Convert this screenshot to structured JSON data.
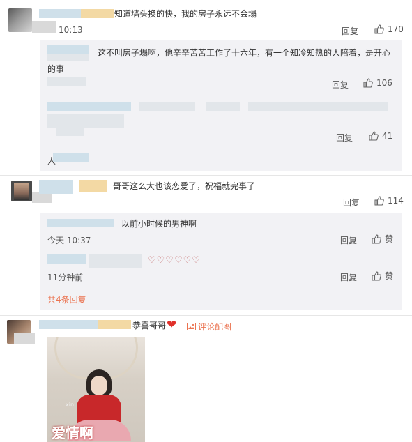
{
  "comments": [
    {
      "text": "知道墙头换的快，我的房子永远不会塌",
      "time": "10:13",
      "reply": "回复",
      "likes": "170",
      "replies": [
        {
          "text": "这不叫房子塌啊，他辛辛苦苦工作了十六年，有一个知冷知热的人陪着，是开心",
          "text2": "的事",
          "reply": "回复",
          "likes": "106"
        },
        {
          "reply": "回复",
          "likes": "41"
        }
      ],
      "more_glyph": "人"
    },
    {
      "text": "哥哥这么大也该恋爱了，祝福就完事了",
      "reply": "回复",
      "likes": "114",
      "replies": [
        {
          "text": "以前小时候的男神啊",
          "time": "今天 10:37",
          "reply": "回复",
          "likes": "赞"
        },
        {
          "emojis": "♡♡♡♡♡♡",
          "time": "11分钟前",
          "reply": "回复",
          "likes": "赞"
        }
      ],
      "total_replies": "共4条回复"
    },
    {
      "text": "恭喜哥哥",
      "heart": "❤",
      "image_link": "评论配图",
      "image_caption": "爱情啊",
      "image_watermark": "xin"
    }
  ],
  "colors": {
    "panel": "#f2f2f5",
    "link": "#eb7350",
    "heart": "#e0302a"
  },
  "icons": {
    "like": "thumbs-up-icon",
    "image": "image-icon",
    "heart": "heart-icon"
  }
}
